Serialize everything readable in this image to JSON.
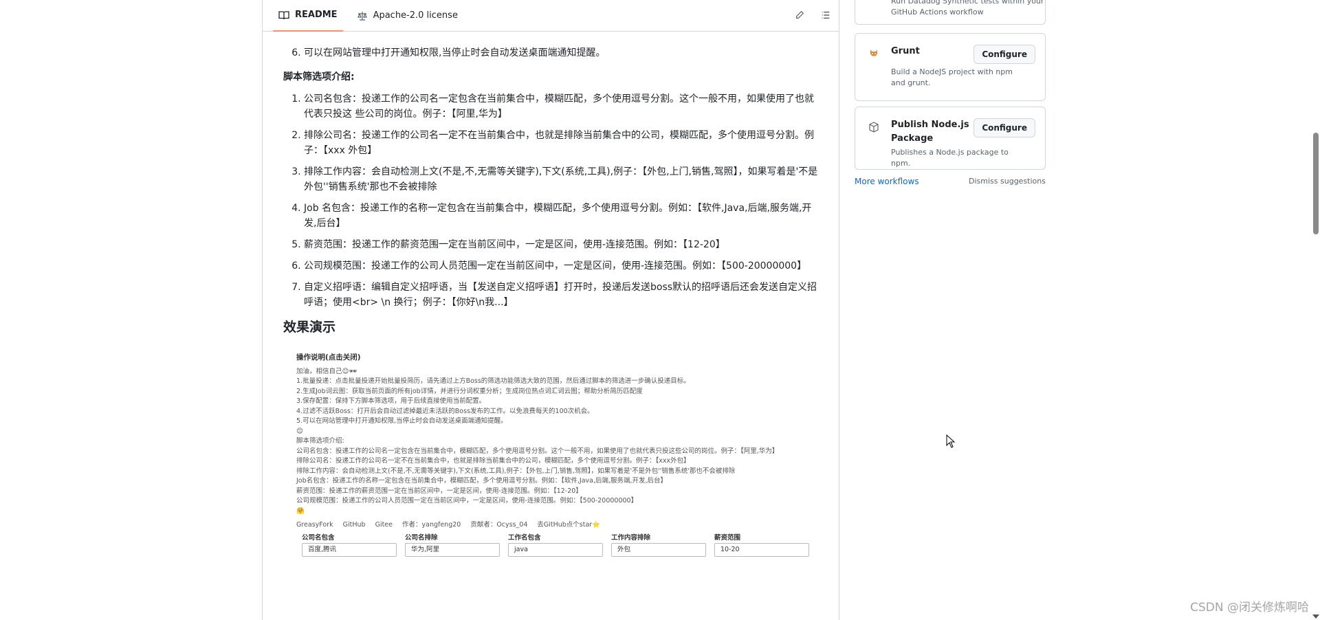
{
  "readme": {
    "tabs": [
      {
        "label": "README"
      },
      {
        "label": "Apache-2.0 license"
      }
    ],
    "top_item": "可以在网站管理中打开通知权限,当停止时会自动发送桌面端通知提醒。",
    "filters_heading": "脚本筛选项介绍:",
    "filters": [
      "公司名包含：投递工作的公司名一定包含在当前集合中，模糊匹配，多个使用逗号分割。这个一般不用，如果使用了也就代表只投这 些公司的岗位。例子：【阿里,华为】",
      "排除公司名：投递工作的公司名一定不在当前集合中，也就是排除当前集合中的公司，模糊匹配，多个使用逗号分割。例子：【xxx 外包】",
      "排除工作内容：会自动检测上文(不是,不,无需等关键字),下文(系统,工具),例子：【外包,上门,销售,驾照】，如果写着是'不是外包''销售系统'那也不会被排除",
      "Job 名包含：投递工作的名称一定包含在当前集合中，模糊匹配，多个使用逗号分割。例如：【软件,Java,后端,服务端,开发,后台】",
      "薪资范围：投递工作的薪资范围一定在当前区间中，一定是区间，使用-连接范围。例如：【12-20】",
      "公司规模范围：投递工作的公司人员范围一定在当前区间中，一定是区间，使用-连接范围。例如：【500-20000000】",
      "自定义招呼语：编辑自定义招呼语，当【发送自定义招呼语】打开时，投递后发送boss默认的招呼语后还会发送自定义招呼语；使用<br> \\n 换行；例子：【你好\\n我...】"
    ],
    "demo_heading": "效果演示"
  },
  "demo_shot": {
    "title": "操作说明(点击关闭)",
    "lines": [
      "加油，相信自己😊🕶",
      "1.批量投递：点击批量投递开始批量投简历，请先通过上方Boss的筛选功能筛选大致的范围，然后通过脚本的筛选进一步确认投递目标。",
      "2.生成Job词云图：获取当前页面的所有job详情，并进行分词权重分析；生成岗位热点词汇词云图；帮助分析简历匹配度",
      "3.保存配置：保持下方脚本筛选项，用于后续直接使用当前配置。",
      "4.过滤不活跃Boss：打开后会自动过滤掉最近未活跃的Boss发布的工作。以免浪费每天的100次机会。",
      "5.可以在网站管理中打开通知权限,当停止时会自动发送桌面端通知提醒。",
      "😊",
      "脚本筛选项介绍:",
      "公司名包含：投递工作的公司名一定包含在当前集合中，模糊匹配，多个使用逗号分割。这个一般不用，如果使用了也就代表只投这些公司的岗位。例子：【阿里,华为】",
      "排除公司名：投递工作的公司名一定不在当前集合中，也就是排除当前集合中的公司，模糊匹配，多个使用逗号分割。例子：【xxx外包】",
      "排除工作内容：会自动检测上文(不是,不,无需等关键字),下文(系统,工具),例子：【外包,上门,销售,驾照】，如果写着是'不是外包''销售系统'那也不会被排除",
      "Job名包含：投递工作的名称一定包含在当前集合中，模糊匹配，多个使用逗号分割。例如：【软件,Java,后端,服务端,开发,后台】",
      "薪资范围：投递工作的薪资范围一定在当前区间中，一定是区间，使用-连接范围。例如：【12-20】",
      "公司规模范围：投递工作的公司人员范围一定在当前区间中，一定是区间，使用-连接范围。例如：【500-20000000】",
      "🤗"
    ],
    "links": [
      "GreasyFork",
      "GitHub",
      "Gitee",
      "作者：yangfeng20",
      "贡献者：Ocyss_04",
      "去GitHub点个star⭐"
    ],
    "fields": [
      {
        "label": "公司名包含",
        "value": "百度,腾讯"
      },
      {
        "label": "公司名排除",
        "value": "华为,阿里"
      },
      {
        "label": "工作名包含",
        "value": "java"
      },
      {
        "label": "工作内容排除",
        "value": "外包"
      },
      {
        "label": "薪资范围",
        "value": "10-20"
      }
    ]
  },
  "workflows": {
    "top_desc_1": "Run Datadog Synthetic tests within your",
    "top_desc_2": "GitHub Actions workflow",
    "grunt": {
      "title": "Grunt",
      "desc": "Build a NodeJS project with npm and grunt.",
      "button": "Configure"
    },
    "publish": {
      "title": "Publish Node.js Package",
      "desc": "Publishes a Node.js package to npm.",
      "button": "Configure"
    },
    "more": "More workflows",
    "dismiss": "Dismiss suggestions"
  },
  "watermark": "CSDN @闭关修炼啊哈",
  "colors": {
    "accent": "#0969da",
    "tab_underline": "#fd8c73",
    "border": "#d0d7de"
  }
}
